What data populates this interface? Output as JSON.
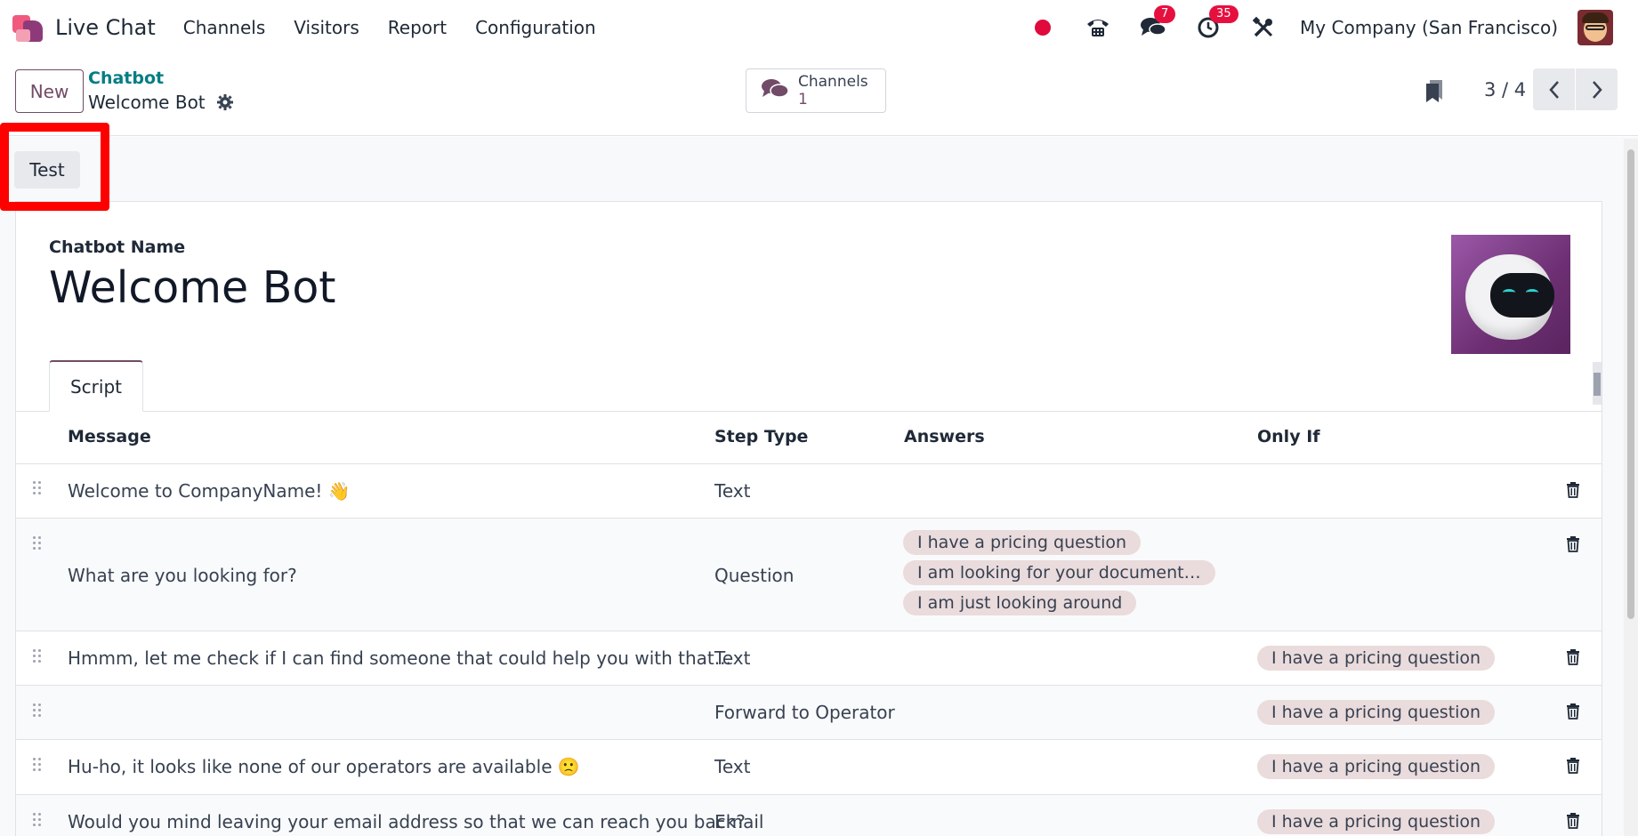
{
  "navbar": {
    "app_name": "Live Chat",
    "menu": [
      "Channels",
      "Visitors",
      "Report",
      "Configuration"
    ],
    "icons": [
      "recording-dot-icon",
      "phone-icon",
      "chat-icon",
      "activity-clock-icon",
      "tools-icon"
    ],
    "messages_badge": "7",
    "activities_badge": "35",
    "company": "My Company (San Francisco)"
  },
  "control": {
    "new_label": "New",
    "breadcrumb_parent": "Chatbot",
    "breadcrumb_current": "Welcome Bot",
    "smart_button": {
      "label": "Channels",
      "value": "1"
    },
    "pager": "3 / 4"
  },
  "actions": {
    "test_label": "Test"
  },
  "form": {
    "name_label": "Chatbot Name",
    "name_value": "Welcome Bot",
    "tab": "Script"
  },
  "table": {
    "headers": {
      "message": "Message",
      "step_type": "Step Type",
      "answers": "Answers",
      "only_if": "Only If"
    },
    "rows": [
      {
        "message": "Welcome to CompanyName! 👋",
        "step_type": "Text",
        "answers": [],
        "only_if": ""
      },
      {
        "message": "What are you looking for?",
        "step_type": "Question",
        "answers": [
          "I have a pricing question",
          "I am looking for your document…",
          "I am just looking around"
        ],
        "only_if": ""
      },
      {
        "message": "Hmmm, let me check if I can find someone that could help you with that...",
        "step_type": "Text",
        "answers": [],
        "only_if": "I have a pricing question"
      },
      {
        "message": "",
        "step_type": "Forward to Operator",
        "answers": [],
        "only_if": "I have a pricing question"
      },
      {
        "message": "Hu-ho, it looks like none of our operators are available 🙁",
        "step_type": "Text",
        "answers": [],
        "only_if": "I have a pricing question"
      },
      {
        "message": "Would you mind leaving your email address so that we can reach you back?",
        "step_type": "Email",
        "answers": [],
        "only_if": "I have a pricing question"
      }
    ]
  },
  "colors": {
    "brand": "#714b67",
    "teal": "#017e84",
    "badge": "#e6103f",
    "highlight": "#ff0000",
    "tag": "#eadbdc"
  }
}
